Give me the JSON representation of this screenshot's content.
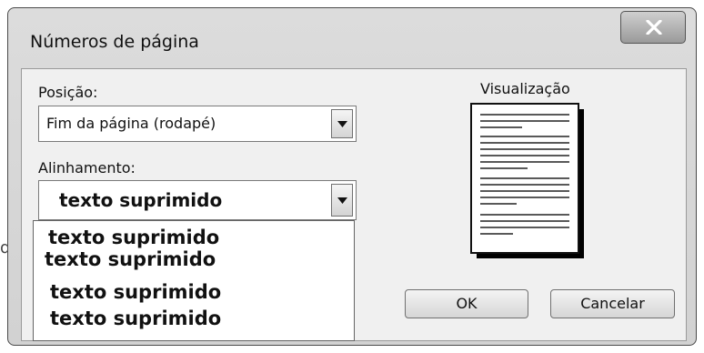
{
  "dialog": {
    "title": "Números de página",
    "close_icon": "close-icon",
    "position_label": "Posição:",
    "position_value": "Fim da página (rodapé)",
    "alignment_label": "Alinhamento:",
    "alignment_value": "texto suprimido",
    "alignment_options": [
      "texto suprimido",
      "texto suprimido",
      "texto suprimido",
      "texto suprimido"
    ],
    "preview_label": "Visualização",
    "ok_label": "OK",
    "cancel_label": "Cancelar"
  },
  "background": {
    "fragment": "d"
  },
  "colors": {
    "title_bar": "#d6d6d6",
    "client": "#f0f0f0",
    "close_button": "#b0b0b0"
  }
}
